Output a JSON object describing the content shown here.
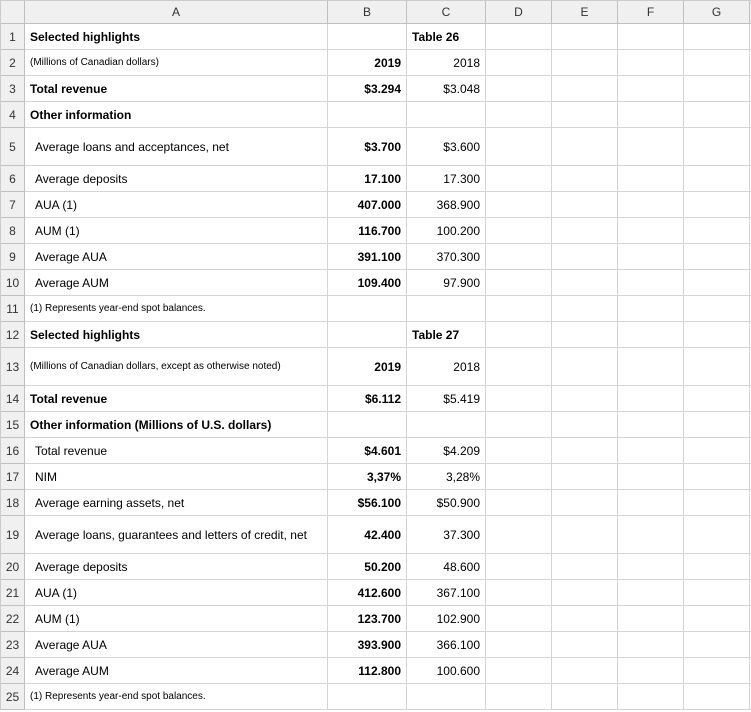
{
  "columns": [
    "A",
    "B",
    "C",
    "D",
    "E",
    "F",
    "G"
  ],
  "rowNumbers": [
    "1",
    "2",
    "3",
    "4",
    "5",
    "6",
    "7",
    "8",
    "9",
    "10",
    "11",
    "12",
    "13",
    "14",
    "15",
    "16",
    "17",
    "18",
    "19",
    "20",
    "21",
    "22",
    "23",
    "24",
    "25"
  ],
  "chart_data": [
    {
      "type": "table",
      "title": "Selected highlights",
      "table_label": "Table 26",
      "subtitle": "(Millions of Canadian dollars)",
      "columns": [
        "2019",
        "2018"
      ],
      "rows": [
        {
          "label": "Total revenue",
          "values": [
            "$3.294",
            "$3.048"
          ],
          "section": ""
        },
        {
          "label": "Average loans and acceptances, net",
          "values": [
            "$3.700",
            "$3.600"
          ],
          "section": "Other information"
        },
        {
          "label": "Average deposits",
          "values": [
            "17.100",
            "17.300"
          ],
          "section": "Other information"
        },
        {
          "label": "AUA (1)",
          "values": [
            "407.000",
            "368.900"
          ],
          "section": "Other information"
        },
        {
          "label": "AUM (1)",
          "values": [
            "116.700",
            "100.200"
          ],
          "section": "Other information"
        },
        {
          "label": "Average AUA",
          "values": [
            "391.100",
            "370.300"
          ],
          "section": "Other information"
        },
        {
          "label": "Average AUM",
          "values": [
            "109.400",
            "97.900"
          ],
          "section": "Other information"
        }
      ],
      "footnote": "(1) Represents year-end spot balances."
    },
    {
      "type": "table",
      "title": "Selected highlights",
      "table_label": "Table 27",
      "subtitle": "(Millions of Canadian dollars, except as otherwise noted)",
      "columns": [
        "2019",
        "2018"
      ],
      "rows": [
        {
          "label": "Total revenue",
          "values": [
            "$6.112",
            "$5.419"
          ],
          "section": ""
        },
        {
          "label": "Total revenue",
          "values": [
            "$4.601",
            "$4.209"
          ],
          "section": "Other information (Millions of U.S. dollars)"
        },
        {
          "label": "NIM",
          "values": [
            "3,37%",
            "3,28%"
          ],
          "section": "Other information (Millions of U.S. dollars)"
        },
        {
          "label": "Average earning assets, net",
          "values": [
            "$56.100",
            "$50.900"
          ],
          "section": "Other information (Millions of U.S. dollars)"
        },
        {
          "label": "Average loans, guarantees and letters of credit, net",
          "values": [
            "42.400",
            "37.300"
          ],
          "section": "Other information (Millions of U.S. dollars)"
        },
        {
          "label": "Average deposits",
          "values": [
            "50.200",
            "48.600"
          ],
          "section": "Other information (Millions of U.S. dollars)"
        },
        {
          "label": "AUA (1)",
          "values": [
            "412.600",
            "367.100"
          ],
          "section": "Other information (Millions of U.S. dollars)"
        },
        {
          "label": "AUM (1)",
          "values": [
            "123.700",
            "102.900"
          ],
          "section": "Other information (Millions of U.S. dollars)"
        },
        {
          "label": "Average AUA",
          "values": [
            "393.900",
            "366.100"
          ],
          "section": "Other information (Millions of U.S. dollars)"
        },
        {
          "label": "Average AUM",
          "values": [
            "112.800",
            "100.600"
          ],
          "section": "Other information (Millions of U.S. dollars)"
        }
      ],
      "footnote": "(1) Represents year-end spot balances."
    }
  ],
  "cells": {
    "r1": {
      "A": "Selected highlights",
      "C": "Table 26"
    },
    "r2": {
      "A": "(Millions of Canadian dollars)",
      "B": "2019",
      "C": "2018"
    },
    "r3": {
      "A": "Total revenue",
      "B": "$3.294",
      "C": "$3.048"
    },
    "r4": {
      "A": "Other information"
    },
    "r5": {
      "A": "Average loans and acceptances, net",
      "B": "$3.700",
      "C": "$3.600"
    },
    "r6": {
      "A": "Average deposits",
      "B": "17.100",
      "C": "17.300"
    },
    "r7": {
      "A": "AUA (1)",
      "B": "407.000",
      "C": "368.900"
    },
    "r8": {
      "A": "AUM (1)",
      "B": "116.700",
      "C": "100.200"
    },
    "r9": {
      "A": "Average AUA",
      "B": "391.100",
      "C": "370.300"
    },
    "r10": {
      "A": "Average AUM",
      "B": "109.400",
      "C": "97.900"
    },
    "r11": {
      "A": "(1) Represents year-end spot balances."
    },
    "r12": {
      "A": "Selected highlights",
      "C": "Table 27"
    },
    "r13": {
      "A": "(Millions of Canadian dollars, except as otherwise noted)",
      "B": "2019",
      "C": "2018"
    },
    "r14": {
      "A": "Total revenue",
      "B": "$6.112",
      "C": "$5.419"
    },
    "r15": {
      "A": "Other information (Millions of U.S. dollars)"
    },
    "r16": {
      "A": "Total revenue",
      "B": "$4.601",
      "C": "$4.209"
    },
    "r17": {
      "A": "NIM",
      "B": "3,37%",
      "C": "3,28%"
    },
    "r18": {
      "A": "Average earning assets, net",
      "B": "$56.100",
      "C": "$50.900"
    },
    "r19": {
      "A": "Average loans, guarantees and letters of credit, net",
      "B": "42.400",
      "C": "37.300"
    },
    "r20": {
      "A": "Average deposits",
      "B": "50.200",
      "C": "48.600"
    },
    "r21": {
      "A": "AUA (1)",
      "B": "412.600",
      "C": "367.100"
    },
    "r22": {
      "A": "AUM (1)",
      "B": "123.700",
      "C": "102.900"
    },
    "r23": {
      "A": "Average AUA",
      "B": "393.900",
      "C": "366.100"
    },
    "r24": {
      "A": "Average AUM",
      "B": "112.800",
      "C": "100.600"
    },
    "r25": {
      "A": "(1) Represents year-end spot balances."
    }
  }
}
